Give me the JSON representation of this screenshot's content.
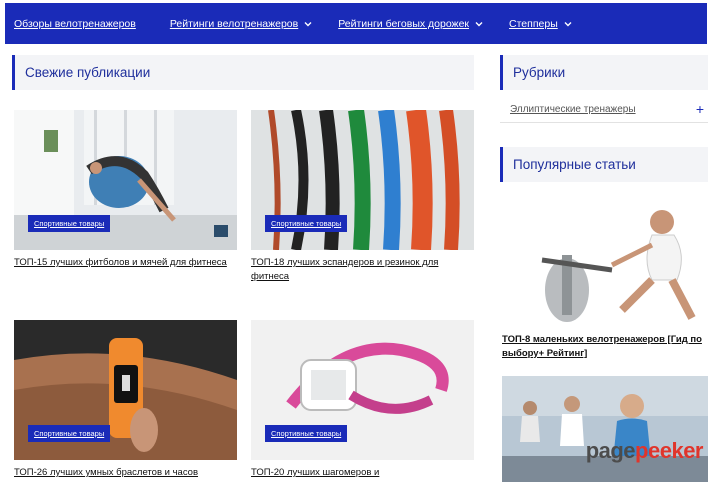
{
  "nav": {
    "items": [
      {
        "label": "Обзоры велотренажеров",
        "dropdown": false
      },
      {
        "label": "Рейтинги велотренажеров",
        "dropdown": true
      },
      {
        "label": "Рейтинги беговых дорожек",
        "dropdown": true
      },
      {
        "label": "Степперы",
        "dropdown": true
      }
    ]
  },
  "main": {
    "section_title": "Свежие публикации",
    "cards": [
      {
        "badge": "Спортивные товары",
        "title": "ТОП-15 лучших фитболов и мячей для фитнеса"
      },
      {
        "badge": "Спортивные товары",
        "title": "ТОП-18 лучших эспандеров и резинок для фитнеса"
      },
      {
        "badge": "Спортивные товары",
        "title": "ТОП-26 лучших умных браслетов и часов"
      },
      {
        "badge": "Спортивные товары",
        "title": "ТОП-20 лучших шагомеров и"
      }
    ]
  },
  "sidebar": {
    "rubrics_title": "Рубрики",
    "rubrics": [
      {
        "label": "Эллиптические тренажеры",
        "expand": "+"
      }
    ],
    "popular_title": "Популярные статьи",
    "popular": [
      {
        "title": "ТОП-8 маленьких велотренажеров [Гид по выбору+ Рейтинг]"
      }
    ]
  },
  "watermark": {
    "part1": "page",
    "part2": "peeker"
  },
  "colors": {
    "brand": "#1a2bb8",
    "header_bg": "#f3f4f7",
    "watermark_red": "#e0352b"
  }
}
